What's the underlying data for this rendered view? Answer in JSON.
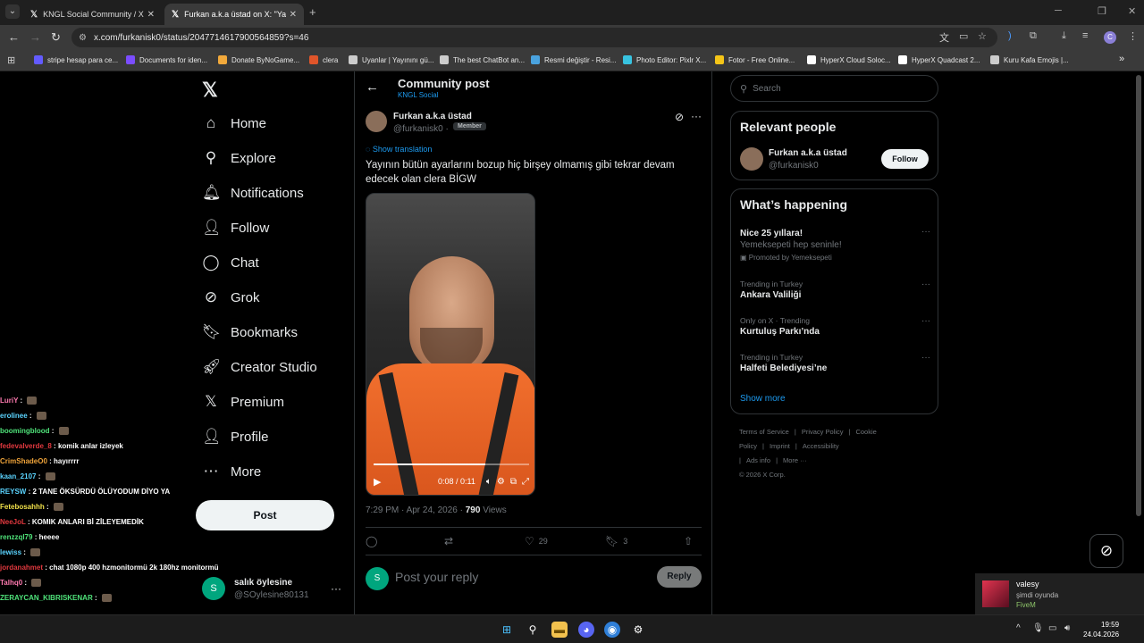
{
  "browser": {
    "tabs": [
      {
        "title": "KNGL Social Community / X",
        "active": false
      },
      {
        "title": "Furkan a.k.a üstad on X: \"Yayını",
        "active": true
      }
    ],
    "url": "x.com/furkanisk0/status/2047714617900564859?s=46",
    "bookmarks": [
      {
        "label": "stripe hesap para ce...",
        "color": "#635bff"
      },
      {
        "label": "Documents for iden...",
        "color": "#7b4dff"
      },
      {
        "label": "Donate ByNoGame...",
        "color": "#f2a93b"
      },
      {
        "label": "clera",
        "color": "#e0552a"
      },
      {
        "label": "Uyanlar | Yayınını gü...",
        "color": "#cccccc"
      },
      {
        "label": "The best ChatBot an...",
        "color": "#cccccc"
      },
      {
        "label": "Resmi değiştir - Resi...",
        "color": "#4aa3df"
      },
      {
        "label": "Photo Editor: Pixlr X...",
        "color": "#38c3e0"
      },
      {
        "label": "Fotor - Free Online...",
        "color": "#f5c518"
      },
      {
        "label": "HyperX Cloud Soloc...",
        "color": "#ffffff"
      },
      {
        "label": "HyperX Quadcast 2...",
        "color": "#ffffff"
      },
      {
        "label": "Kuru Kafa Emojis |...",
        "color": "#cccccc"
      }
    ],
    "profile_initial": "C"
  },
  "nav": {
    "items": [
      {
        "label": "Home",
        "icon": "home-icon",
        "glyph": "⌂"
      },
      {
        "label": "Explore",
        "icon": "search-icon",
        "glyph": "⚲"
      },
      {
        "label": "Notifications",
        "icon": "bell-icon",
        "glyph": "🔔︎"
      },
      {
        "label": "Follow",
        "icon": "person-add-icon",
        "glyph": "👤︎"
      },
      {
        "label": "Chat",
        "icon": "chat-icon",
        "glyph": "◯"
      },
      {
        "label": "Grok",
        "icon": "grok-icon",
        "glyph": "⊘"
      },
      {
        "label": "Bookmarks",
        "icon": "bookmark-icon",
        "glyph": "🔖︎"
      },
      {
        "label": "Creator Studio",
        "icon": "rocket-icon",
        "glyph": "🚀︎"
      },
      {
        "label": "Premium",
        "icon": "x-icon",
        "glyph": "𝕏"
      },
      {
        "label": "Profile",
        "icon": "profile-icon",
        "glyph": "👤︎"
      },
      {
        "label": "More",
        "icon": "more-icon",
        "glyph": "⋯"
      }
    ],
    "post_label": "Post",
    "account": {
      "initial": "S",
      "name": "salık öylesine",
      "handle": "@SOylesine80131"
    }
  },
  "chat_overlay": [
    {
      "user": "LuriY",
      "color": "#ff7ab0",
      "msg": "",
      "emote": true
    },
    {
      "user": "erolinee",
      "color": "#5bd4ff",
      "msg": "",
      "emote": true
    },
    {
      "user": "boomingblood",
      "color": "#4fe37a",
      "msg": "",
      "emote": true
    },
    {
      "user": "fedevalverde_8",
      "color": "#e0383e",
      "msg": "komik anlar izleyek",
      "emote": false
    },
    {
      "user": "CrimShadeO0",
      "color": "#f0a43a",
      "msg": "hayırrrr",
      "emote": false
    },
    {
      "user": "kaan_2107",
      "color": "#5bd4ff",
      "msg": "",
      "emote": true
    },
    {
      "user": "REYSW",
      "color": "#5bd4ff",
      "msg": "2 TANE ÖKSÜRDÜ ÖLÜYODUM DİYO YA",
      "emote": false
    },
    {
      "user": "Fetebosahhh",
      "color": "#f0e04a",
      "msg": "",
      "emote": true
    },
    {
      "user": "NeeJoL",
      "color": "#e0383e",
      "msg": "KOMIK ANLARI Bİ ZİLEYEMEDİK",
      "emote": false
    },
    {
      "user": "renzzql79",
      "color": "#4fe37a",
      "msg": "heeee",
      "emote": false
    },
    {
      "user": "lewiss",
      "color": "#5bd4ff",
      "msg": "",
      "emote": true
    },
    {
      "user": "jordanahmet",
      "color": "#e0383e",
      "msg": "chat 1080p 400 hzmonitormü 2k 180hz monitormü",
      "emote": false
    },
    {
      "user": "Talhq0",
      "color": "#ff7ab0",
      "msg": "",
      "emote": true
    },
    {
      "user": "ZERAYCAN_KIBRISKENAR",
      "color": "#4fe37a",
      "msg": "",
      "emote": true
    }
  ],
  "post": {
    "header_title": "Community post",
    "header_sub": "KNGL Social",
    "author_name": "Furkan a.k.a üstad",
    "author_handle": "@furkanisk0 ·",
    "badge": "Member",
    "show_translation": "Show translation",
    "text": "Yayının bütün ayarlarını bozup hiç birşey olmamış gibi tekrar devam edecek olan  clera BİGW",
    "video_time": "0:08 / 0:11",
    "video_progress": 0.72,
    "timestamp": "7:29 PM · Apr 24, 2026 · ",
    "views_count": "790",
    "views_label": " Views",
    "likes": "29",
    "bookmarks": "3",
    "reply_initial": "S",
    "reply_placeholder": "Post your reply",
    "reply_button": "Reply"
  },
  "sidebar": {
    "search_placeholder": "Search",
    "relevant_title": "Relevant people",
    "relevant": {
      "name": "Furkan a.k.a üstad",
      "handle": "@furkanisk0",
      "follow_label": "Follow"
    },
    "happening_title": "What’s happening",
    "trends": [
      {
        "context": "",
        "name": "Nice 25 yıllara!",
        "sub": "Yemeksepeti hep seninle!",
        "promo": "Promoted by Yemeksepeti"
      },
      {
        "context": "Trending in Turkey",
        "name": "Ankara Valiliği",
        "sub": "",
        "promo": ""
      },
      {
        "context": "Only on X · Trending",
        "name": "Kurtuluş Parkı’nda",
        "sub": "",
        "promo": ""
      },
      {
        "context": "Trending in Turkey",
        "name": "Halfeti Belediyesi’ne",
        "sub": "",
        "promo": ""
      }
    ],
    "show_more": "Show more",
    "footer": [
      "Terms of Service",
      "|",
      "Privacy Policy",
      "|",
      "Cookie Policy",
      "|",
      "Imprint",
      "|",
      "Accessibility",
      "|",
      "Ads info",
      "|",
      "More ···",
      "© 2026 X Corp."
    ]
  },
  "notification": {
    "title": "valesy",
    "sub": "şimdi oyunda",
    "game": "FiveM"
  },
  "taskbar": {
    "time": "19:59",
    "date": "24.04.2026"
  }
}
